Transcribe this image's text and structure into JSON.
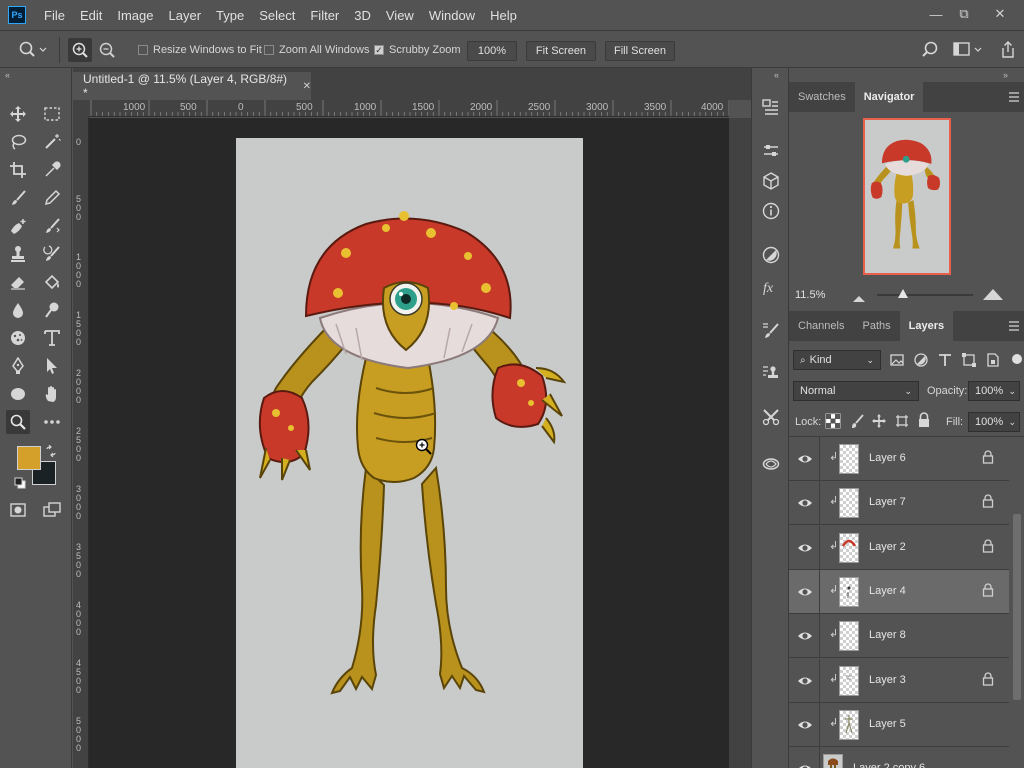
{
  "app": {
    "logo": "Ps"
  },
  "menu": [
    "File",
    "Edit",
    "Image",
    "Layer",
    "Type",
    "Select",
    "Filter",
    "3D",
    "View",
    "Window",
    "Help"
  ],
  "window_controls": {
    "minimize": "—",
    "restore": "⧉",
    "close": "✕"
  },
  "options_bar": {
    "resize_windows_label": "Resize Windows to Fit",
    "resize_windows_checked": false,
    "zoom_all_label": "Zoom All Windows",
    "zoom_all_checked": false,
    "scrubby_zoom_label": "Scrubby Zoom",
    "scrubby_zoom_checked": true,
    "zoom_value": "100%",
    "fit_screen_label": "Fit Screen",
    "fill_screen_label": "Fill Screen"
  },
  "document": {
    "tab_title": "Untitled-1 @ 11.5% (Layer 4, RGB/8#) *",
    "close_glyph": "✕"
  },
  "rulers": {
    "horizontal": [
      "1000",
      "500",
      "0",
      "500",
      "1000",
      "1500",
      "2000",
      "2500",
      "3000",
      "3500",
      "4000"
    ],
    "vertical": [
      "0",
      "5 0 0",
      "1 0 0 0",
      "1 5 0 0",
      "2 0 0 0",
      "2 5 0 0",
      "3 0 0 0",
      "3 5 0 0",
      "4 0 0 0",
      "4 5 0 0",
      "5 0 0 0",
      "5 5 0 0"
    ]
  },
  "colors": {
    "foreground": "#d4a02a",
    "background": "#1a2226",
    "canvas_bg": "#c8cbc9",
    "navigator_border": "#e8604c"
  },
  "navigator_panel": {
    "tabs": [
      "Swatches",
      "Navigator"
    ],
    "active_tab": "Navigator",
    "zoom_readout": "11.5%",
    "zoom_slider_position": 0.27
  },
  "layers_panel": {
    "tabs": [
      "Channels",
      "Paths",
      "Layers"
    ],
    "active_tab": "Layers",
    "filter_kind": "Kind",
    "blend_mode": "Normal",
    "opacity_label": "Opacity:",
    "opacity_value": "100%",
    "lock_label": "Lock:",
    "fill_label": "Fill:",
    "fill_value": "100%",
    "layers": [
      {
        "name": "Layer 6",
        "clipped": true,
        "locked": true,
        "selected": false,
        "thumb": "empty"
      },
      {
        "name": "Layer 7",
        "clipped": true,
        "locked": true,
        "selected": false,
        "thumb": "empty"
      },
      {
        "name": "Layer 2",
        "clipped": true,
        "locked": true,
        "selected": false,
        "thumb": "red"
      },
      {
        "name": "Layer 4",
        "clipped": true,
        "locked": true,
        "selected": true,
        "thumb": "dark"
      },
      {
        "name": "Layer 8",
        "clipped": true,
        "locked": false,
        "selected": false,
        "thumb": "empty"
      },
      {
        "name": "Layer 3",
        "clipped": true,
        "locked": true,
        "selected": false,
        "thumb": "gray"
      },
      {
        "name": "Layer 5",
        "clipped": true,
        "locked": false,
        "selected": false,
        "thumb": "figure"
      },
      {
        "name": "Layer 2 copy 6",
        "clipped": false,
        "locked": false,
        "selected": false,
        "thumb": "brown"
      }
    ]
  }
}
